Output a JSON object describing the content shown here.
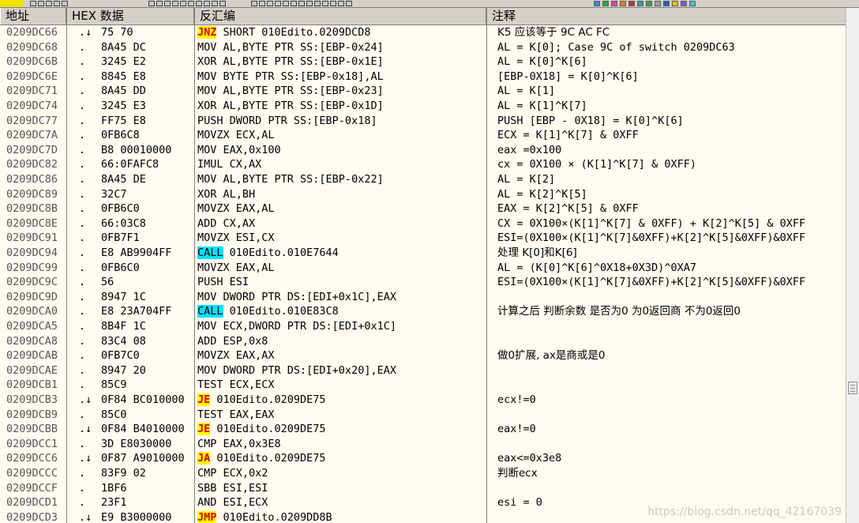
{
  "columns": {
    "address": "地址",
    "hex": "HEX 数据",
    "disasm": "反汇编",
    "comment": "注释"
  },
  "rows": [
    {
      "addr": "0209DC66",
      "sym": ".↓",
      "hex": "75 70",
      "mnem": "JNZ",
      "hl": "y",
      "rest": " SHORT 010Edito.0209DCD8",
      "comment": "K5 应该等于 9C AC FC"
    },
    {
      "addr": "0209DC68",
      "sym": ".",
      "hex": "8A45 DC",
      "mnem": "",
      "hl": "",
      "rest": "MOV AL,BYTE PTR SS:[EBP-0x24]",
      "comment": "AL = K[0]; Case 9C of switch 0209DC63"
    },
    {
      "addr": "0209DC6B",
      "sym": ".",
      "hex": "3245 E2",
      "mnem": "",
      "hl": "",
      "rest": "XOR AL,BYTE PTR SS:[EBP-0x1E]",
      "comment": "AL = K[0]^K[6]"
    },
    {
      "addr": "0209DC6E",
      "sym": ".",
      "hex": "8845 E8",
      "mnem": "",
      "hl": "",
      "rest": "MOV BYTE PTR SS:[EBP-0x18],AL",
      "comment": "[EBP-0X18] = K[0]^K[6]"
    },
    {
      "addr": "0209DC71",
      "sym": ".",
      "hex": "8A45 DD",
      "mnem": "",
      "hl": "",
      "rest": "MOV AL,BYTE PTR SS:[EBP-0x23]",
      "comment": "AL = K[1]"
    },
    {
      "addr": "0209DC74",
      "sym": ".",
      "hex": "3245 E3",
      "mnem": "",
      "hl": "",
      "rest": "XOR AL,BYTE PTR SS:[EBP-0x1D]",
      "comment": "AL = K[1]^K[7]"
    },
    {
      "addr": "0209DC77",
      "sym": ".",
      "hex": "FF75 E8",
      "mnem": "",
      "hl": "",
      "rest": "PUSH DWORD PTR SS:[EBP-0x18]",
      "comment": "PUSH [EBP - 0X18] = K[0]^K[6]"
    },
    {
      "addr": "0209DC7A",
      "sym": ".",
      "hex": "0FB6C8",
      "mnem": "",
      "hl": "",
      "rest": "MOVZX ECX,AL",
      "comment": "ECX = K[1]^K[7] & 0XFF"
    },
    {
      "addr": "0209DC7D",
      "sym": ".",
      "hex": "B8 00010000",
      "mnem": "",
      "hl": "",
      "rest": "MOV EAX,0x100",
      "comment": "eax =0x100"
    },
    {
      "addr": "0209DC82",
      "sym": ".",
      "hex": "66:0FAFC8",
      "mnem": "",
      "hl": "",
      "rest": "IMUL CX,AX",
      "comment": "cx = 0X100 × (K[1]^K[7] & 0XFF)"
    },
    {
      "addr": "0209DC86",
      "sym": ".",
      "hex": "8A45 DE",
      "mnem": "",
      "hl": "",
      "rest": "MOV AL,BYTE PTR SS:[EBP-0x22]",
      "comment": "AL = K[2]"
    },
    {
      "addr": "0209DC89",
      "sym": ".",
      "hex": "32C7",
      "mnem": "",
      "hl": "",
      "rest": "XOR AL,BH",
      "comment": "AL = K[2]^K[5]"
    },
    {
      "addr": "0209DC8B",
      "sym": ".",
      "hex": "0FB6C0",
      "mnem": "",
      "hl": "",
      "rest": "MOVZX EAX,AL",
      "comment": "EAX = K[2]^K[5] & 0XFF"
    },
    {
      "addr": "0209DC8E",
      "sym": ".",
      "hex": "66:03C8",
      "mnem": "",
      "hl": "",
      "rest": "ADD CX,AX",
      "comment": "CX = 0X100×(K[1]^K[7] & 0XFF) + K[2]^K[5] & 0XFF"
    },
    {
      "addr": "0209DC91",
      "sym": ".",
      "hex": "0FB7F1",
      "mnem": "",
      "hl": "",
      "rest": "MOVZX ESI,CX",
      "comment": "ESI=(0X100×(K[1]^K[7]&0XFF)+K[2]^K[5]&0XFF)&0XFF"
    },
    {
      "addr": "0209DC94",
      "sym": ".",
      "hex": "E8 AB9904FF",
      "mnem": "CALL",
      "hl": "c",
      "rest": " 010Edito.010E7644",
      "comment": "处理 K[0]和K[6]"
    },
    {
      "addr": "0209DC99",
      "sym": ".",
      "hex": "0FB6C0",
      "mnem": "",
      "hl": "",
      "rest": "MOVZX EAX,AL",
      "comment": "AL = (K[0]^K[6]^0X18+0X3D)^0XA7"
    },
    {
      "addr": "0209DC9C",
      "sym": ".",
      "hex": "56",
      "mnem": "",
      "hl": "",
      "rest": "PUSH ESI",
      "comment": "ESI=(0X100×(K[1]^K[7]&0XFF)+K[2]^K[5]&0XFF)&0XFF"
    },
    {
      "addr": "0209DC9D",
      "sym": ".",
      "hex": "8947 1C",
      "mnem": "",
      "hl": "",
      "rest": "MOV DWORD PTR DS:[EDI+0x1C],EAX",
      "comment": ""
    },
    {
      "addr": "0209DCA0",
      "sym": ".",
      "hex": "E8 23A704FF",
      "mnem": "CALL",
      "hl": "c",
      "rest": " 010Edito.010E83C8",
      "comment": "计算之后 判断余数 是否为0 为0返回商 不为0返回0"
    },
    {
      "addr": "0209DCA5",
      "sym": ".",
      "hex": "8B4F 1C",
      "mnem": "",
      "hl": "",
      "rest": "MOV ECX,DWORD PTR DS:[EDI+0x1C]",
      "comment": ""
    },
    {
      "addr": "0209DCA8",
      "sym": ".",
      "hex": "83C4 08",
      "mnem": "",
      "hl": "",
      "rest": "ADD ESP,0x8",
      "comment": ""
    },
    {
      "addr": "0209DCAB",
      "sym": ".",
      "hex": "0FB7C0",
      "mnem": "",
      "hl": "",
      "rest": "MOVZX EAX,AX",
      "comment": "做0扩展, ax是商或是0"
    },
    {
      "addr": "0209DCAE",
      "sym": ".",
      "hex": "8947 20",
      "mnem": "",
      "hl": "",
      "rest": "MOV DWORD PTR DS:[EDI+0x20],EAX",
      "comment": ""
    },
    {
      "addr": "0209DCB1",
      "sym": ".",
      "hex": "85C9",
      "mnem": "",
      "hl": "",
      "rest": "TEST ECX,ECX",
      "comment": ""
    },
    {
      "addr": "0209DCB3",
      "sym": ".↓",
      "hex": "0F84 BC010000",
      "mnem": "JE",
      "hl": "y",
      "rest": " 010Edito.0209DE75",
      "comment": "ecx!=0"
    },
    {
      "addr": "0209DCB9",
      "sym": ".",
      "hex": "85C0",
      "mnem": "",
      "hl": "",
      "rest": "TEST EAX,EAX",
      "comment": ""
    },
    {
      "addr": "0209DCBB",
      "sym": ".↓",
      "hex": "0F84 B4010000",
      "mnem": "JE",
      "hl": "y",
      "rest": " 010Edito.0209DE75",
      "comment": "eax!=0"
    },
    {
      "addr": "0209DCC1",
      "sym": ".",
      "hex": "3D E8030000",
      "mnem": "",
      "hl": "",
      "rest": "CMP EAX,0x3E8",
      "comment": ""
    },
    {
      "addr": "0209DCC6",
      "sym": ".↓",
      "hex": "0F87 A9010000",
      "mnem": "JA",
      "hl": "y",
      "rest": " 010Edito.0209DE75",
      "comment": "eax<=0x3e8"
    },
    {
      "addr": "0209DCCC",
      "sym": ".",
      "hex": "83F9 02",
      "mnem": "",
      "hl": "",
      "rest": "CMP ECX,0x2",
      "comment": "判断ecx"
    },
    {
      "addr": "0209DCCF",
      "sym": ".",
      "hex": "1BF6",
      "mnem": "",
      "hl": "",
      "rest": "SBB ESI,ESI",
      "comment": ""
    },
    {
      "addr": "0209DCD1",
      "sym": ".",
      "hex": "23F1",
      "mnem": "",
      "hl": "",
      "rest": "AND ESI,ECX",
      "comment": "esi = 0"
    },
    {
      "addr": "0209DCD3",
      "sym": ".↓",
      "hex": "E9 B3000000",
      "mnem": "JMP",
      "hl": "y",
      "rest": " 010Edito.0209DD8B",
      "comment": ""
    }
  ],
  "watermark": "https://blog.csdn.net/qq_42167039",
  "colors": {
    "jump_highlight": "#ffff00",
    "jump_text": "#e00000",
    "call_highlight": "#00e0ff",
    "background": "#fffbf0"
  }
}
